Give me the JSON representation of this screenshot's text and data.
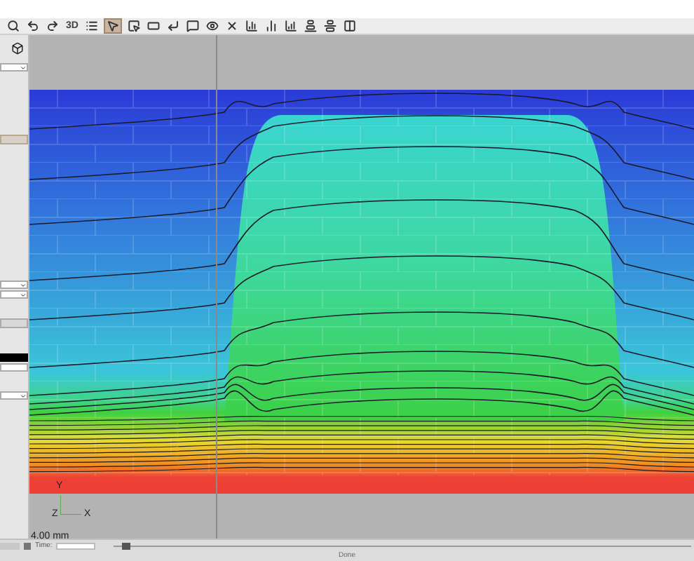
{
  "toolbar": [
    {
      "kind": "icon",
      "selected": false
    },
    {
      "kind": "icon",
      "selected": false
    },
    {
      "kind": "icon",
      "selected": false
    },
    {
      "kind": "text",
      "label": "3D",
      "selected": false
    },
    {
      "kind": "icon",
      "selected": false
    },
    {
      "kind": "icon",
      "selected": true
    },
    {
      "kind": "icon",
      "selected": false
    },
    {
      "kind": "icon",
      "selected": false
    },
    {
      "kind": "icon",
      "selected": false
    },
    {
      "kind": "icon",
      "selected": false
    },
    {
      "kind": "icon",
      "selected": false
    },
    {
      "kind": "icon",
      "selected": false
    },
    {
      "kind": "icon",
      "selected": false
    },
    {
      "kind": "icon",
      "selected": false
    },
    {
      "kind": "icon",
      "selected": false
    },
    {
      "kind": "icon",
      "selected": false
    },
    {
      "kind": "icon",
      "selected": false
    },
    {
      "kind": "icon",
      "selected": false
    }
  ],
  "canvas": {
    "axes": {
      "y": "Y",
      "z": "Z",
      "x": "X"
    },
    "scale": "4.00 mm"
  },
  "status_bar": {
    "time_label": "Time:",
    "time_slider": {
      "level": 0.02
    },
    "status": "Done"
  }
}
